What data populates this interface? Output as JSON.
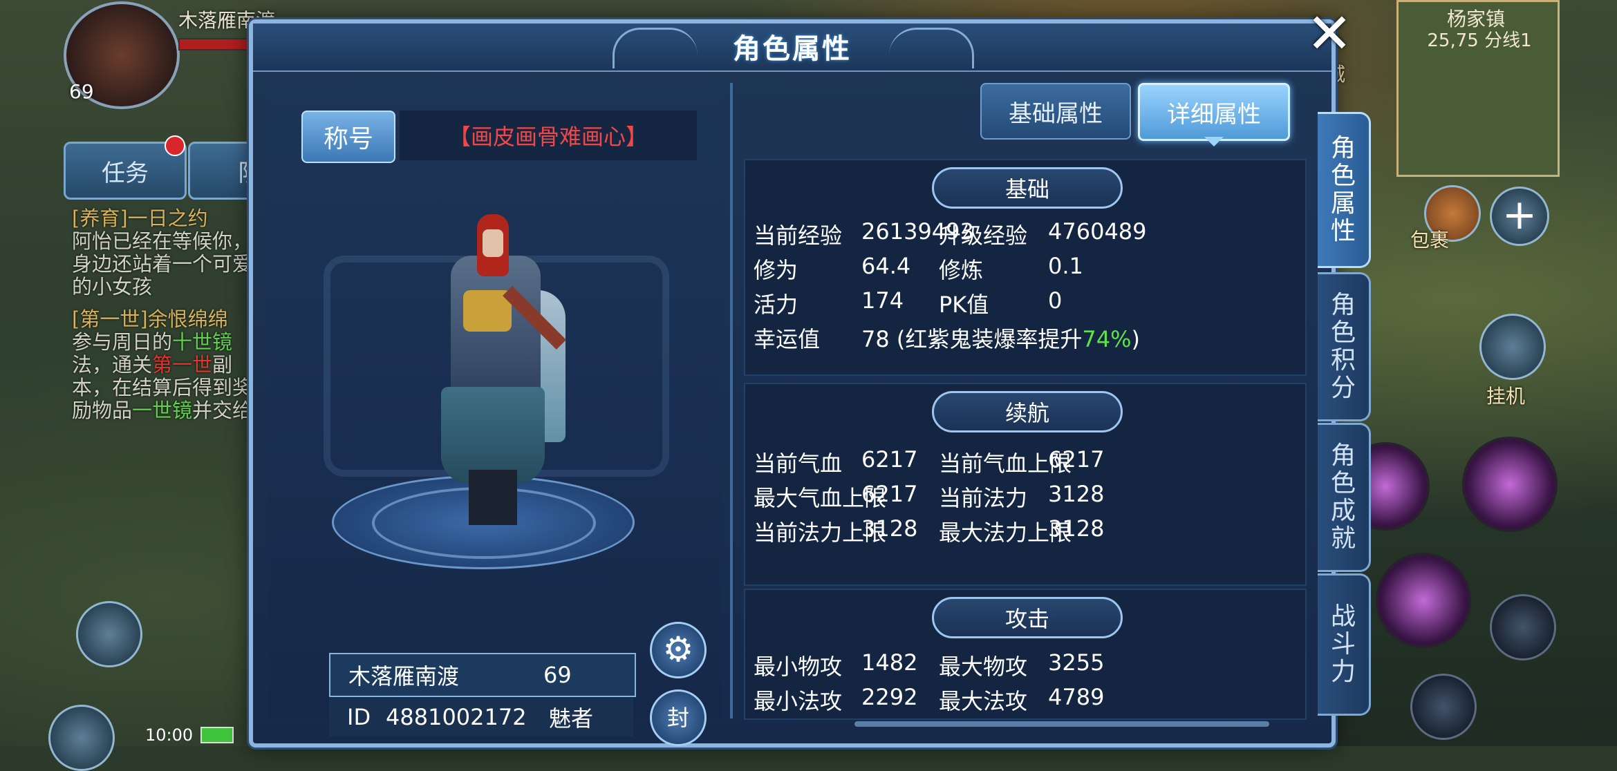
{
  "hud": {
    "player_name": "木落雁南渡",
    "player_level": "69",
    "quest_tabs": [
      "任务",
      "队"
    ],
    "quests": [
      {
        "title": "[养育]一日之约",
        "text": "阿怡已经在等候你，身边还站着一个可爱的小女孩"
      },
      {
        "title": "[第一世]余恨绵绵",
        "text_parts": [
          "参与周日的",
          "十世镜",
          "法，通关",
          "第一世",
          "副本，在结算后得到奖励物品",
          "一世镜",
          "并交给"
        ]
      }
    ],
    "time": "10:00",
    "map_name": "杨家镇",
    "map_coord": "25,75 分线1",
    "shop_label": "商城",
    "bag_label": "包裹",
    "hook_label": "挂机"
  },
  "panel": {
    "title": "角色属性",
    "close": "✕",
    "title_button": "称号",
    "title_value": "【画皮画骨难画心】",
    "char_name": "木落雁南渡",
    "char_level": "69",
    "char_id_label": "ID",
    "char_id": "4881002172",
    "char_class": "魅者",
    "gear_icon": "⚙",
    "seal_label": "封",
    "tabs": [
      "基础属性",
      "详细属性"
    ],
    "side_tabs": [
      "角色属性",
      "角色积分",
      "角色成就",
      "战斗力"
    ]
  },
  "sections": {
    "basic": {
      "head": "基础",
      "rows": [
        [
          "当前经验",
          "26139493",
          "升级经验",
          "4760489"
        ],
        [
          "修为",
          "64.4",
          "修炼",
          "0.1"
        ],
        [
          "活力",
          "174",
          "PK值",
          "0"
        ]
      ],
      "luck_label": "幸运值",
      "luck_value": "78 (红紫鬼装爆率提升",
      "luck_pct": "74%",
      "luck_tail": ")"
    },
    "endurance": {
      "head": "续航",
      "rows": [
        [
          "当前气血",
          "6217",
          "当前气血上限",
          "6217"
        ],
        [
          "最大气血上限",
          "6217",
          "当前法力",
          "3128"
        ],
        [
          "当前法力上限",
          "3128",
          "最大法力上限",
          "3128"
        ]
      ]
    },
    "attack": {
      "head": "攻击",
      "rows": [
        [
          "最小物攻",
          "1482",
          "最大物攻",
          "3255"
        ],
        [
          "最小法攻",
          "2292",
          "最大法攻",
          "4789"
        ]
      ]
    }
  },
  "colors": {
    "accent": "#8eb5dd",
    "title_red": "#f04848",
    "pct_green": "#5ee14a"
  }
}
